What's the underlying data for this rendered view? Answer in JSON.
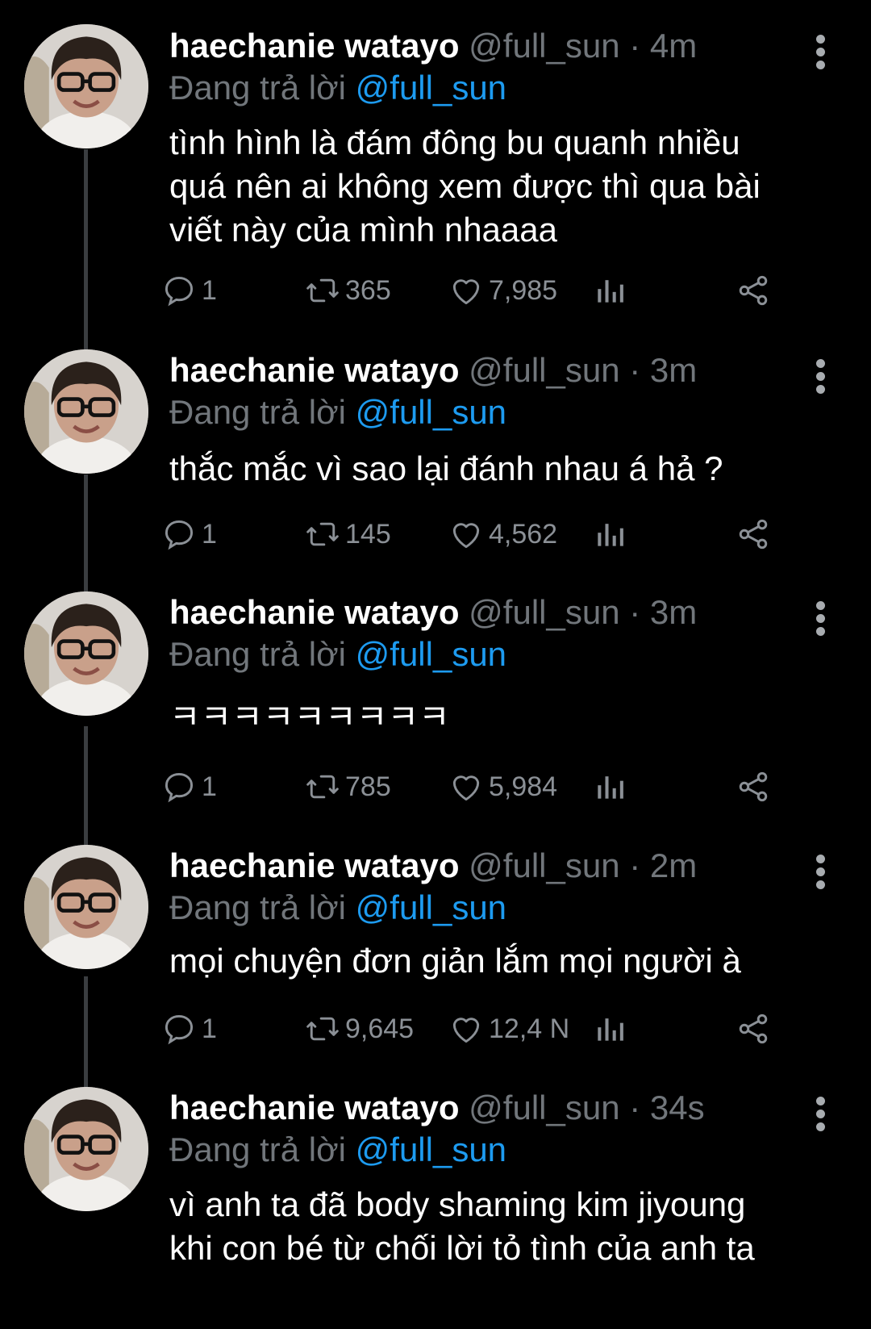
{
  "tweets": [
    {
      "name": "haechanie watayo",
      "handle": "@full_sun",
      "dot": "·",
      "time": "4m",
      "reply_prefix": "Đang trả lời",
      "reply_mention": "@full_sun",
      "lines": [
        "tình hình là đám đông bu quanh nhiều",
        "quá nên ai không xem được thì qua bài",
        "viết này của mình nhaaaa"
      ],
      "replies": "1",
      "retweets": "365",
      "likes": "7,985"
    },
    {
      "name": "haechanie watayo",
      "handle": "@full_sun",
      "dot": "·",
      "time": "3m",
      "reply_prefix": "Đang trả lời",
      "reply_mention": "@full_sun",
      "lines": [
        "thắc mắc vì sao lại đánh nhau á hả ?"
      ],
      "replies": "1",
      "retweets": "145",
      "likes": "4,562"
    },
    {
      "name": "haechanie watayo",
      "handle": "@full_sun",
      "dot": "·",
      "time": "3m",
      "reply_prefix": "Đang trả lời",
      "reply_mention": "@full_sun",
      "lines": [
        "ㅋㅋㅋㅋㅋㅋㅋㅋㅋ"
      ],
      "replies": "1",
      "retweets": "785",
      "likes": "5,984"
    },
    {
      "name": "haechanie watayo",
      "handle": "@full_sun",
      "dot": "·",
      "time": "2m",
      "reply_prefix": "Đang trả lời",
      "reply_mention": "@full_sun",
      "lines": [
        "mọi chuyện đơn giản lắm mọi người à"
      ],
      "replies": "1",
      "retweets": "9,645",
      "likes": "12,4 N"
    },
    {
      "name": "haechanie watayo",
      "handle": "@full_sun",
      "dot": "·",
      "time": "34s",
      "reply_prefix": "Đang trả lời",
      "reply_mention": "@full_sun",
      "lines": [
        "vì anh ta đã body shaming kim jiyoung",
        "khi con bé từ chối lời tỏ tình của anh ta"
      ],
      "replies": "",
      "retweets": "",
      "likes": ""
    }
  ],
  "icons": {
    "reply": "reply-icon",
    "retweet": "retweet-icon",
    "like": "heart-icon",
    "analytics": "analytics-icon",
    "share": "share-icon",
    "more": "more-vertical-icon"
  },
  "colors": {
    "background": "#000000",
    "mention": "#1d9bf0",
    "muted": "#71767b"
  }
}
